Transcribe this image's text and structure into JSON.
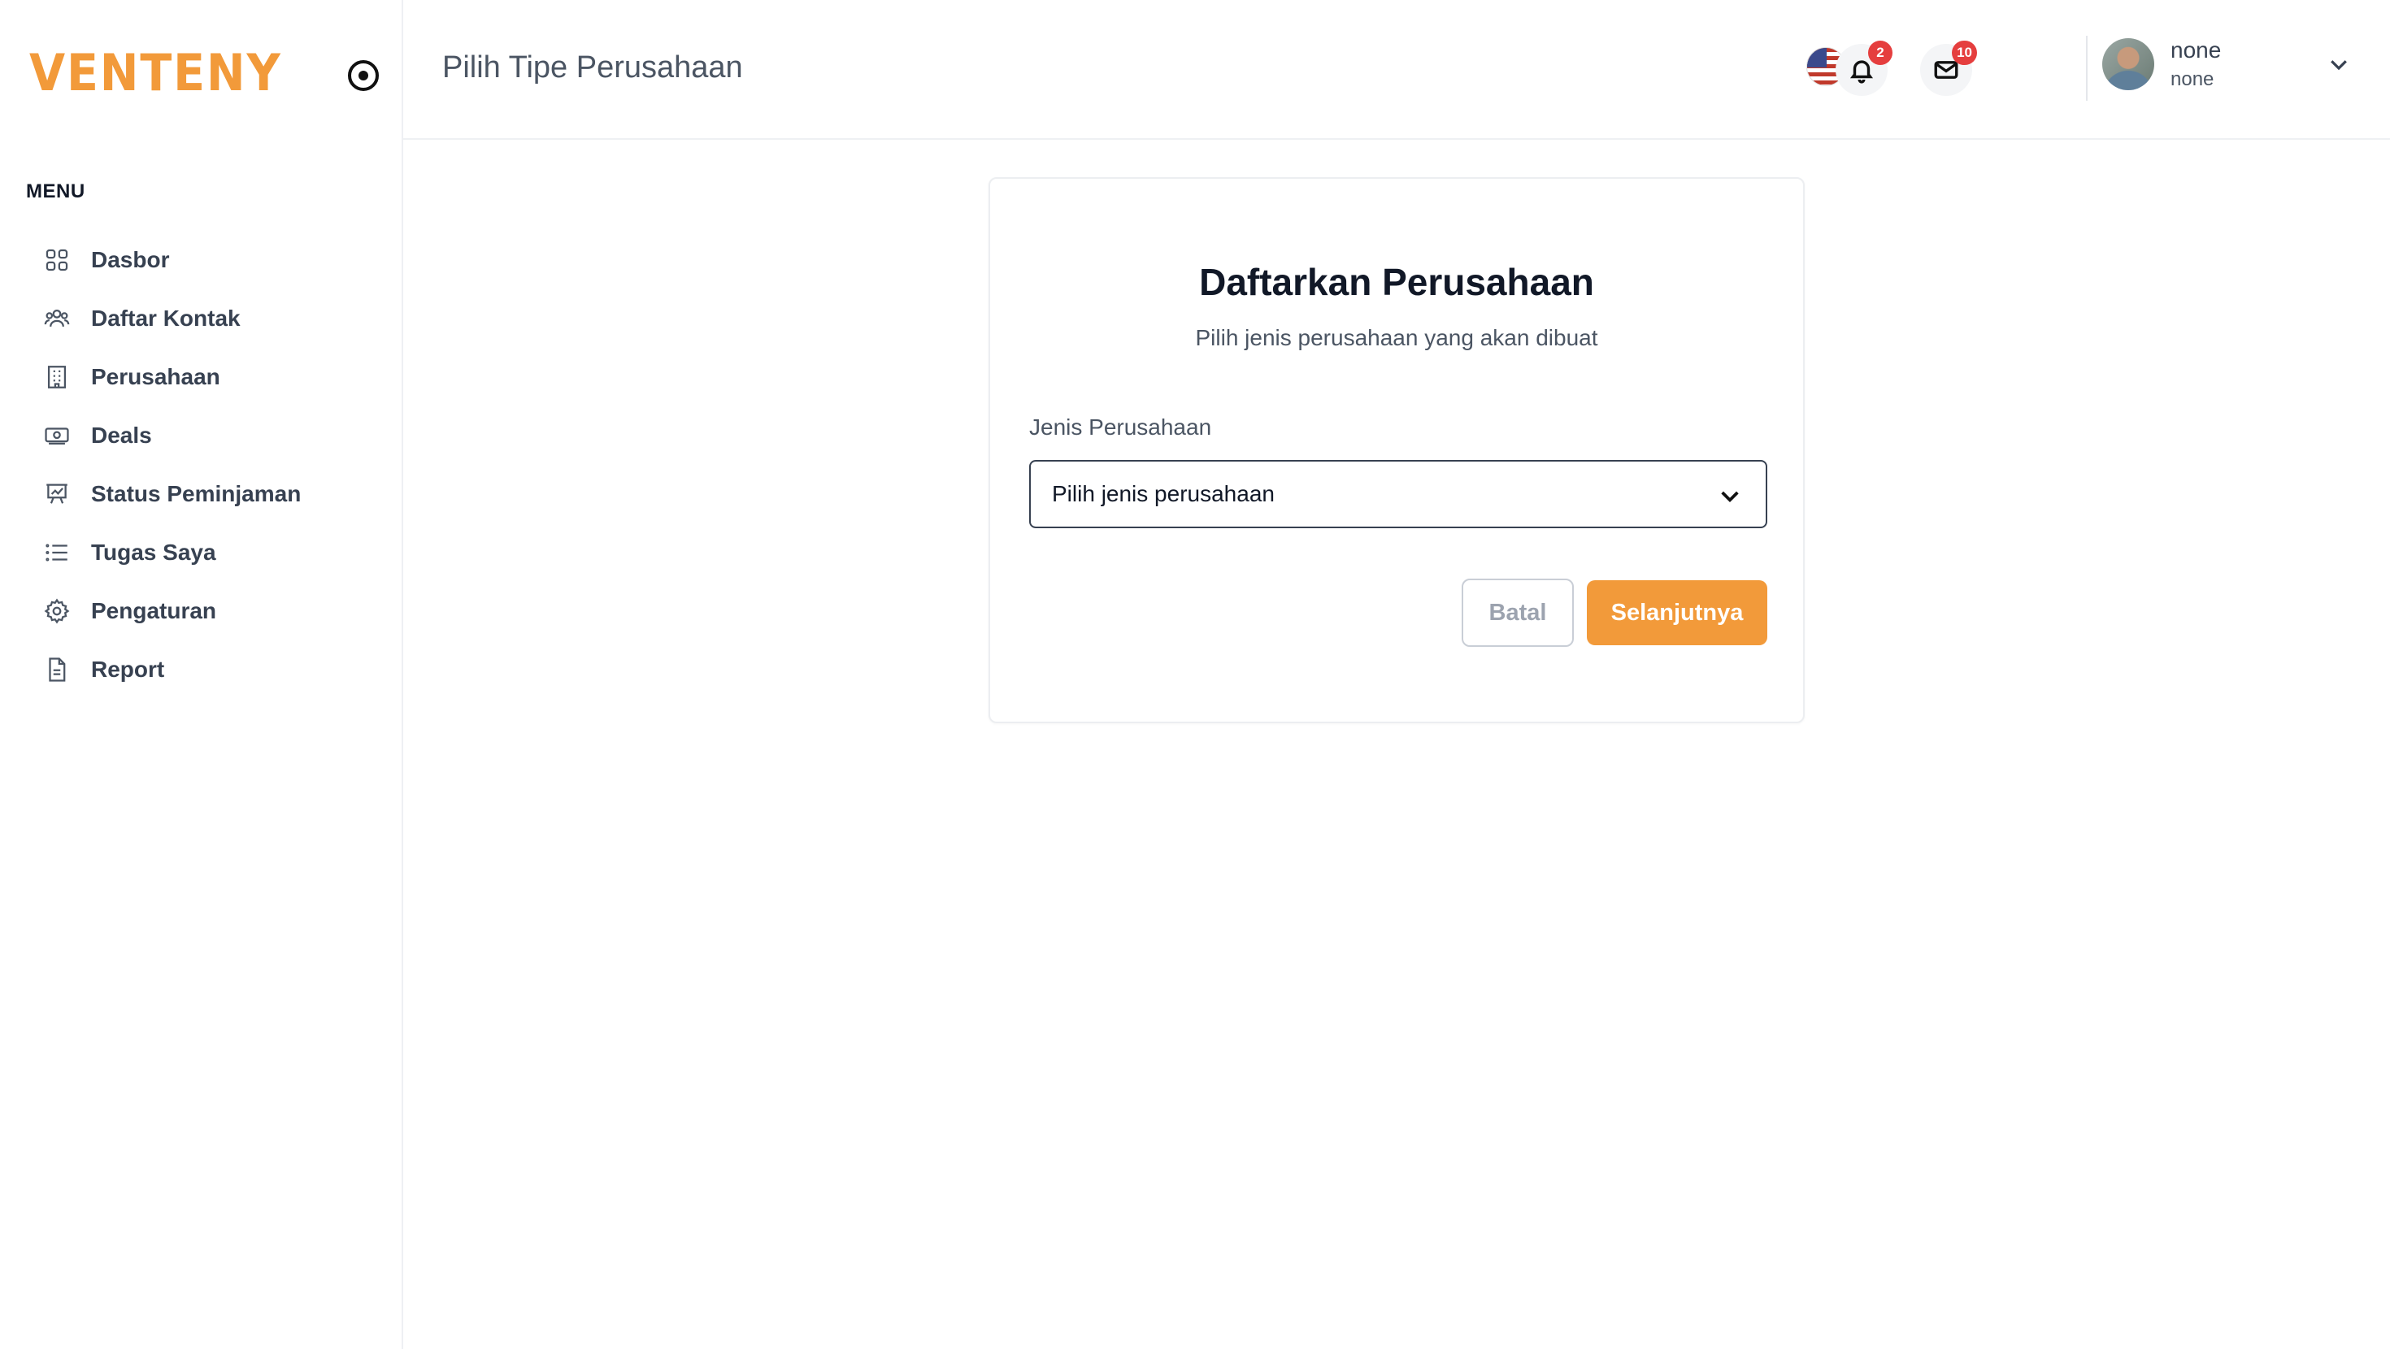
{
  "app": {
    "logo_text": "VENTENY",
    "brand_color": "#f29a3a"
  },
  "sidebar": {
    "menu_title": "MENU",
    "items": [
      {
        "label": "Dasbor",
        "icon": "grid-icon"
      },
      {
        "label": "Daftar Kontak",
        "icon": "users-icon"
      },
      {
        "label": "Perusahaan",
        "icon": "building-icon"
      },
      {
        "label": "Deals",
        "icon": "banknote-icon"
      },
      {
        "label": "Status Peminjaman",
        "icon": "presentation-chart-icon"
      },
      {
        "label": "Tugas Saya",
        "icon": "list-icon"
      },
      {
        "label": "Pengaturan",
        "icon": "gear-icon"
      },
      {
        "label": "Report",
        "icon": "document-icon"
      }
    ]
  },
  "header": {
    "title": "Pilih Tipe Perusahaan",
    "language": "En",
    "notifications_count": "2",
    "messages_count": "10",
    "user": {
      "name": "none",
      "role": "none"
    }
  },
  "form": {
    "title": "Daftarkan Perusahaan",
    "subtitle": "Pilih jenis perusahaan yang akan dibuat",
    "field_label": "Jenis Perusahaan",
    "select_value": "Pilih jenis perusahaan",
    "cancel_label": "Batal",
    "next_label": "Selanjutnya"
  }
}
